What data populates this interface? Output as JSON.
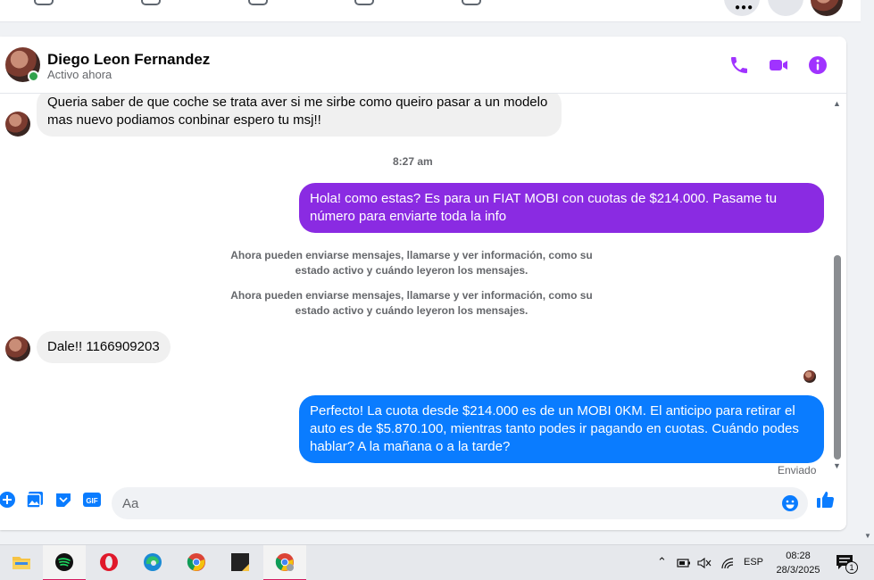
{
  "chat": {
    "contact_name": "Diego Leon Fernandez",
    "status": "Activo ahora",
    "messages": [
      {
        "kind": "incoming",
        "text": "Queria saber de que coche se trata aver si me sirbe como queiro pasar a un modelo mas nuevo podiamos conbinar espero tu msj!!"
      },
      {
        "kind": "time",
        "text": "8:27 am"
      },
      {
        "kind": "outgoing",
        "text": "Hola! como estas? Es para un FIAT MOBI con cuotas de $214.000. Pasame tu número para enviarte toda la info"
      },
      {
        "kind": "system",
        "text": "Ahora pueden enviarse mensajes, llamarse y ver información, como su estado activo y cuándo leyeron los mensajes."
      },
      {
        "kind": "system",
        "text": "Ahora pueden enviarse mensajes, llamarse y ver información, como su estado activo y cuándo leyeron los mensajes."
      },
      {
        "kind": "incoming",
        "text": "Dale!! 1166909203"
      },
      {
        "kind": "outgoing",
        "text": "Perfecto! La cuota desde $214.000 es de un MOBI 0KM. El anticipo para retirar el auto es de $5.870.100, mientras tanto podes ir pagando en cuotas. Cuándo podes hablar? A la mañana o a la tarde?"
      },
      {
        "kind": "status",
        "text": "Enviado"
      }
    ],
    "composer_placeholder": "Aa",
    "colors": {
      "accent": "#a033ff",
      "bubble_purple": "#8a2be2",
      "bubble_blue": "#0a7cff",
      "incoming_bubble": "#f0f0f0",
      "online": "#31a24c"
    },
    "header_icons": [
      "phone-icon",
      "video-icon",
      "info-icon"
    ],
    "composer_icons": [
      "plus-circle-icon",
      "photo-icon",
      "sticker-icon",
      "gif-icon",
      "emoji-icon",
      "like-icon"
    ]
  },
  "taskbar": {
    "apps": [
      "file-explorer",
      "spotify",
      "opera",
      "edge",
      "chrome",
      "sticky-notes",
      "chrome-profile"
    ],
    "language": "ESP",
    "time": "08:28",
    "date": "28/3/2025",
    "notification_count": "1"
  }
}
